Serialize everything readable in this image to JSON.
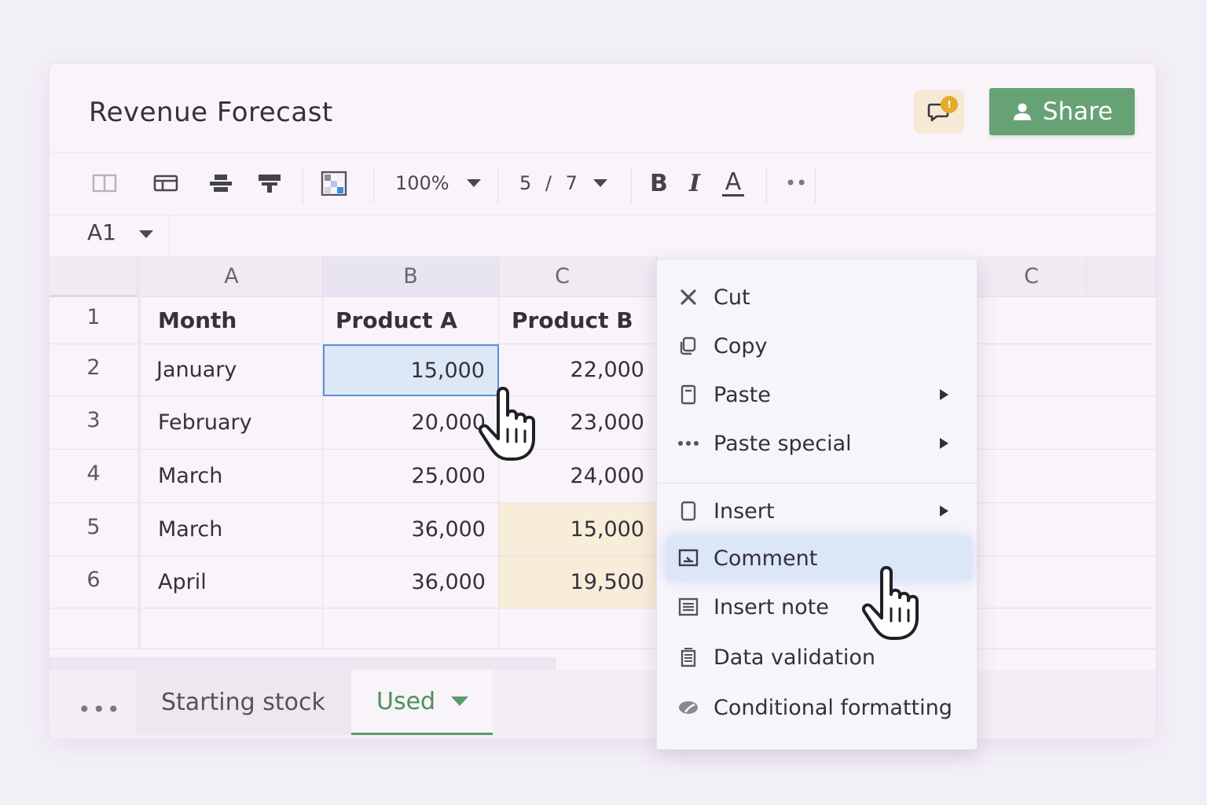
{
  "doc": {
    "title": "Revenue Forecast"
  },
  "header": {
    "comment_badge": "!",
    "share_label": "Share"
  },
  "toolbar": {
    "zoom": "100%",
    "font_size": "5 / 7",
    "bold": "B",
    "italic": "I",
    "text_color": "A",
    "more": "••",
    "icons": [
      "split-view-icon",
      "table-icon",
      "print-icon",
      "paint-format-icon",
      "color-grid-icon"
    ]
  },
  "name_box": {
    "value": "A1"
  },
  "columns": [
    {
      "label": "A"
    },
    {
      "label": "B"
    },
    {
      "label": "C"
    },
    {
      "label": "C"
    }
  ],
  "rows": [
    {
      "num": "1",
      "month": "Month",
      "a": "Product A",
      "b": "Product B"
    },
    {
      "num": "2",
      "month": "January",
      "a": "15,000",
      "b": "22,000"
    },
    {
      "num": "3",
      "month": "February",
      "a": "20,000",
      "b": "23,000"
    },
    {
      "num": "4",
      "month": "March",
      "a": "25,000",
      "b": "24,000"
    },
    {
      "num": "5",
      "month": "March",
      "a": "36,000",
      "b": "15,000"
    },
    {
      "num": "6",
      "month": "April",
      "a": "36,000",
      "b": "19,500"
    }
  ],
  "sheets": {
    "more": "•••",
    "tabs": [
      {
        "label": "Starting stock"
      },
      {
        "label": "Used"
      }
    ]
  },
  "context_menu": {
    "items": [
      {
        "label": "Cut",
        "icon": "cut-icon"
      },
      {
        "label": "Copy",
        "icon": "copy-icon"
      },
      {
        "label": "Paste",
        "icon": "paste-icon"
      },
      {
        "label": "Paste special",
        "icon": "more-icon"
      },
      {
        "label": "Insert",
        "icon": "insert-icon"
      },
      {
        "label": "Comment",
        "icon": "comment-icon"
      },
      {
        "label": "Insert note",
        "icon": "note-icon"
      },
      {
        "label": "Data validation",
        "icon": "validation-icon"
      },
      {
        "label": "Conditional formatting",
        "icon": "formatting-icon"
      }
    ]
  },
  "colors": {
    "share_button": "#66a274",
    "selection": "#5d8fd6",
    "highlight_row": "#dbe6f6",
    "yellow_cells": "#f8edd9",
    "active_tab": "#5c9b69",
    "badge": "#e3ac2b"
  }
}
